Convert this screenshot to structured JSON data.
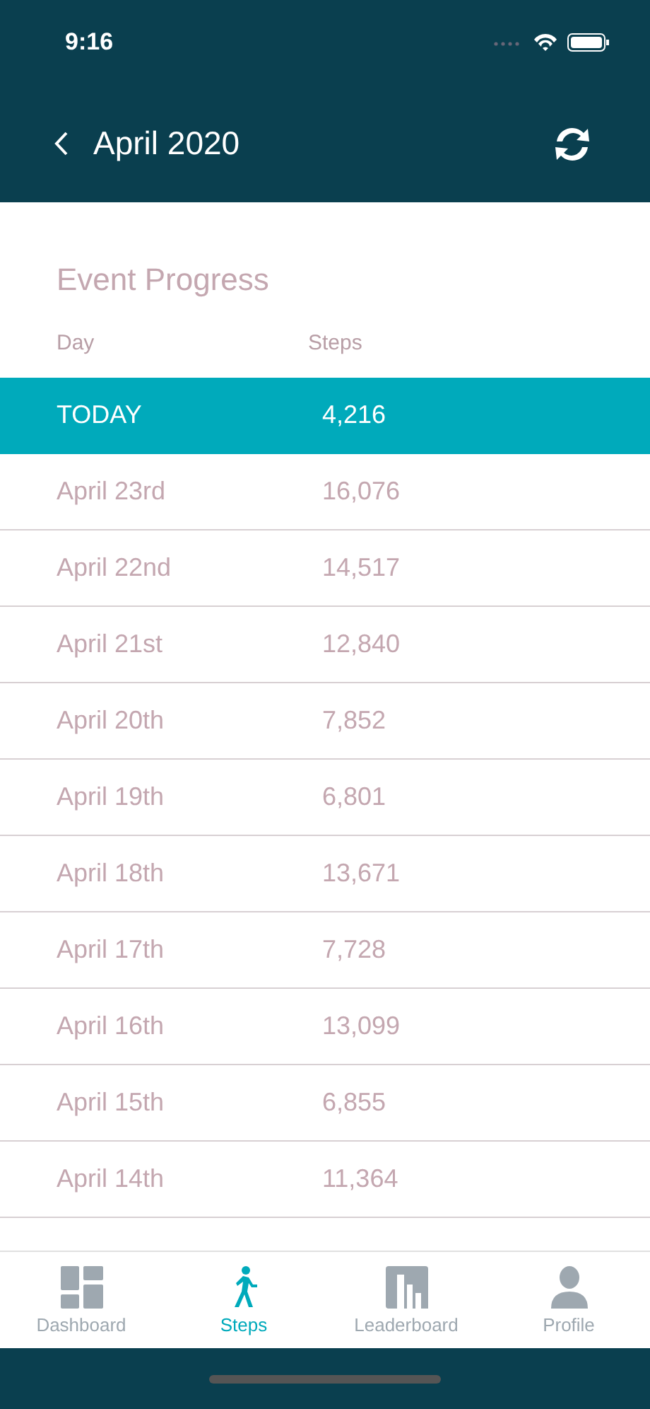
{
  "status_bar": {
    "time": "9:16"
  },
  "header": {
    "title": "April 2020"
  },
  "section_title": "Event Progress",
  "table": {
    "columns": [
      "Day",
      "Steps"
    ],
    "rows": [
      {
        "day": "TODAY",
        "steps": "4,216",
        "selected": true
      },
      {
        "day": "April 23rd",
        "steps": "16,076",
        "selected": false
      },
      {
        "day": "April 22nd",
        "steps": "14,517",
        "selected": false
      },
      {
        "day": "April 21st",
        "steps": "12,840",
        "selected": false
      },
      {
        "day": "April 20th",
        "steps": "7,852",
        "selected": false
      },
      {
        "day": "April 19th",
        "steps": "6,801",
        "selected": false
      },
      {
        "day": "April 18th",
        "steps": "13,671",
        "selected": false
      },
      {
        "day": "April 17th",
        "steps": "7,728",
        "selected": false
      },
      {
        "day": "April 16th",
        "steps": "13,099",
        "selected": false
      },
      {
        "day": "April 15th",
        "steps": "6,855",
        "selected": false
      },
      {
        "day": "April 14th",
        "steps": "11,364",
        "selected": false
      }
    ]
  },
  "tab_bar": [
    {
      "label": "Dashboard",
      "kind": "dashboard",
      "selected": false
    },
    {
      "label": "Steps",
      "kind": "steps",
      "selected": true
    },
    {
      "label": "Leaderboard",
      "kind": "leaderboard",
      "selected": false
    },
    {
      "label": "Profile",
      "kind": "profile",
      "selected": false
    }
  ]
}
